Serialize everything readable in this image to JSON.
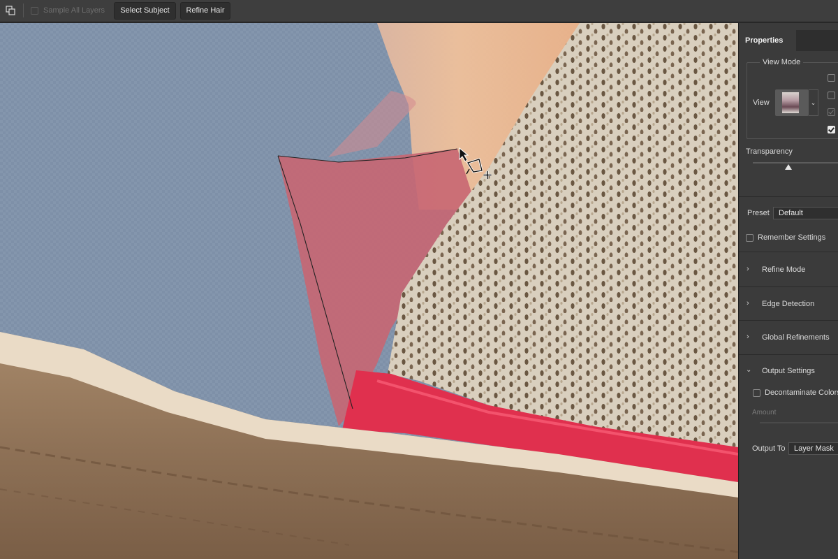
{
  "options_bar": {
    "tool_icon": "overlap-squares-icon",
    "sample_all_layers_label": "Sample All Layers",
    "sample_all_layers_checked": false,
    "select_subject_label": "Select Subject",
    "refine_hair_label": "Refine Hair"
  },
  "canvas": {
    "cursor_icon": "polygonal-lasso-add-icon",
    "selection_shape": "polygon"
  },
  "properties": {
    "tab_label": "Properties",
    "view_mode": {
      "title": "View Mode",
      "view_label": "View",
      "thumbnail_icon": "view-mode-thumbnail",
      "dropdown_icon": "chevron-down-icon",
      "options": [
        {
          "checked": false
        },
        {
          "checked": false
        },
        {
          "checked": true,
          "disabled": true
        },
        {
          "checked": true
        }
      ]
    },
    "transparency": {
      "label": "Transparency",
      "value_fraction": 0.4
    },
    "preset": {
      "label": "Preset",
      "value": "Default"
    },
    "remember_settings": {
      "label": "Remember Settings",
      "checked": false
    },
    "sections": {
      "refine_mode": {
        "label": "Refine Mode",
        "expanded": false
      },
      "edge_detection": {
        "label": "Edge Detection",
        "expanded": false
      },
      "global_refinements": {
        "label": "Global Refinements",
        "expanded": false
      },
      "output_settings": {
        "label": "Output Settings",
        "expanded": true
      }
    },
    "decontaminate": {
      "label": "Decontaminate Colors",
      "checked": false
    },
    "amount": {
      "label": "Amount"
    },
    "output_to": {
      "label": "Output To",
      "value": "Layer Mask"
    }
  }
}
